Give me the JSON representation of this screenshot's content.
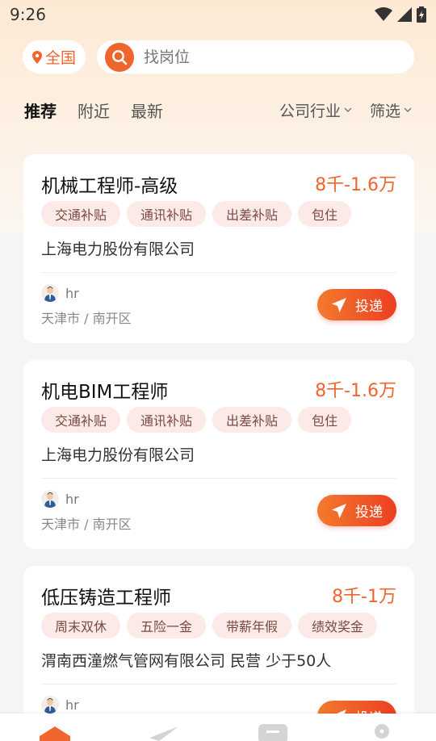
{
  "status_bar": {
    "time": "9:26"
  },
  "location": {
    "label": "全国"
  },
  "search": {
    "placeholder": "找岗位"
  },
  "tabs": [
    {
      "label": "推荐",
      "active": true
    },
    {
      "label": "附近",
      "active": false
    },
    {
      "label": "最新",
      "active": false
    }
  ],
  "filters": {
    "industry": "公司行业",
    "filter": "筛选"
  },
  "jobs": [
    {
      "title": "机械工程师-高级",
      "salary": "8千-1.6万",
      "tags": [
        "交通补贴",
        "通讯补贴",
        "出差补贴",
        "包住"
      ],
      "company": "上海电力股份有限公司",
      "hr": "hr",
      "location": "天津市 / 南开区",
      "apply_label": "投递"
    },
    {
      "title": "机电BIM工程师",
      "salary": "8千-1.6万",
      "tags": [
        "交通补贴",
        "通讯补贴",
        "出差补贴",
        "包住"
      ],
      "company": "上海电力股份有限公司",
      "hr": "hr",
      "location": "天津市 / 南开区",
      "apply_label": "投递"
    },
    {
      "title": "低压铸造工程师",
      "salary": "8千-1万",
      "tags": [
        "周末双休",
        "五险一金",
        "带薪年假",
        "绩效奖金"
      ],
      "company": "渭南西潼燃气管网有限公司 民营 少于50人",
      "hr": "hr",
      "location": "",
      "apply_label": "投递"
    }
  ],
  "colors": {
    "accent": "#f0642d",
    "tag_bg": "#fbeae7"
  },
  "bottom_nav": [
    {
      "icon": "home-icon"
    },
    {
      "icon": "send-icon"
    },
    {
      "icon": "message-icon"
    },
    {
      "icon": "profile-icon"
    }
  ]
}
